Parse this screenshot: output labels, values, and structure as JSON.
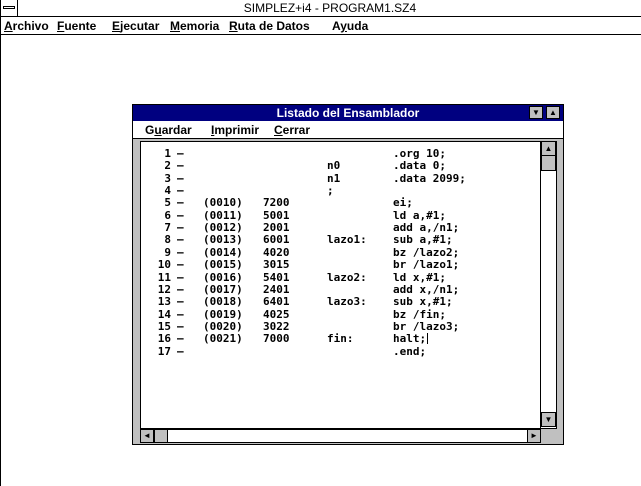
{
  "window": {
    "title": "SIMPLEZ+i4 - PROGRAM1.SZ4"
  },
  "menubar": [
    {
      "pre": "",
      "u": "A",
      "post": "rchivo"
    },
    {
      "pre": "",
      "u": "F",
      "post": "uente"
    },
    {
      "pre": "",
      "u": "E",
      "post": "jecutar"
    },
    {
      "pre": "",
      "u": "M",
      "post": "emoria"
    },
    {
      "pre": "",
      "u": "R",
      "post": "uta de Datos"
    },
    {
      "pre": "A",
      "u": "y",
      "post": "uda"
    }
  ],
  "dialog": {
    "title": "Listado del Ensamblador",
    "menu": [
      {
        "pre": "G",
        "u": "u",
        "post": "ardar"
      },
      {
        "pre": "",
        "u": "I",
        "post": "mprimir"
      },
      {
        "pre": "",
        "u": "C",
        "post": "errar"
      }
    ],
    "lines": [
      {
        "num": "1",
        "addr": "",
        "code": "",
        "label": "",
        "instr": ".org 10;"
      },
      {
        "num": "2",
        "addr": "",
        "code": "",
        "label": "n0",
        "instr": ".data 0;"
      },
      {
        "num": "3",
        "addr": "",
        "code": "",
        "label": "n1",
        "instr": ".data 2099;"
      },
      {
        "num": "4",
        "addr": "",
        "code": "",
        "label": ";",
        "instr": ""
      },
      {
        "num": "5",
        "addr": "(0010)",
        "code": "7200",
        "label": "",
        "instr": "ei;"
      },
      {
        "num": "6",
        "addr": "(0011)",
        "code": "5001",
        "label": "",
        "instr": "ld a,#1;"
      },
      {
        "num": "7",
        "addr": "(0012)",
        "code": "2001",
        "label": "",
        "instr": "add a,/n1;"
      },
      {
        "num": "8",
        "addr": "(0013)",
        "code": "6001",
        "label": "lazo1:",
        "instr": "sub a,#1;"
      },
      {
        "num": "9",
        "addr": "(0014)",
        "code": "4020",
        "label": "",
        "instr": "bz /lazo2;"
      },
      {
        "num": "10",
        "addr": "(0015)",
        "code": "3015",
        "label": "",
        "instr": "br /lazo1;"
      },
      {
        "num": "11",
        "addr": "(0016)",
        "code": "5401",
        "label": "lazo2:",
        "instr": "ld x,#1;"
      },
      {
        "num": "12",
        "addr": "(0017)",
        "code": "2401",
        "label": "",
        "instr": "add x,/n1;"
      },
      {
        "num": "13",
        "addr": "(0018)",
        "code": "6401",
        "label": "lazo3:",
        "instr": "sub x,#1;"
      },
      {
        "num": "14",
        "addr": "(0019)",
        "code": "4025",
        "label": "",
        "instr": "bz /fin;"
      },
      {
        "num": "15",
        "addr": "(0020)",
        "code": "3022",
        "label": "",
        "instr": "br /lazo3;"
      },
      {
        "num": "16",
        "addr": "(0021)",
        "code": "7000",
        "label": "fin:",
        "instr": "halt;"
      },
      {
        "num": "17",
        "addr": "",
        "code": "",
        "label": "",
        "instr": ".end;"
      }
    ],
    "dash": "–"
  },
  "icons": {
    "minimize": "▼",
    "maximize": "▲",
    "scroll_up": "▲",
    "scroll_down": "▼",
    "scroll_left": "◄",
    "scroll_right": "►"
  }
}
